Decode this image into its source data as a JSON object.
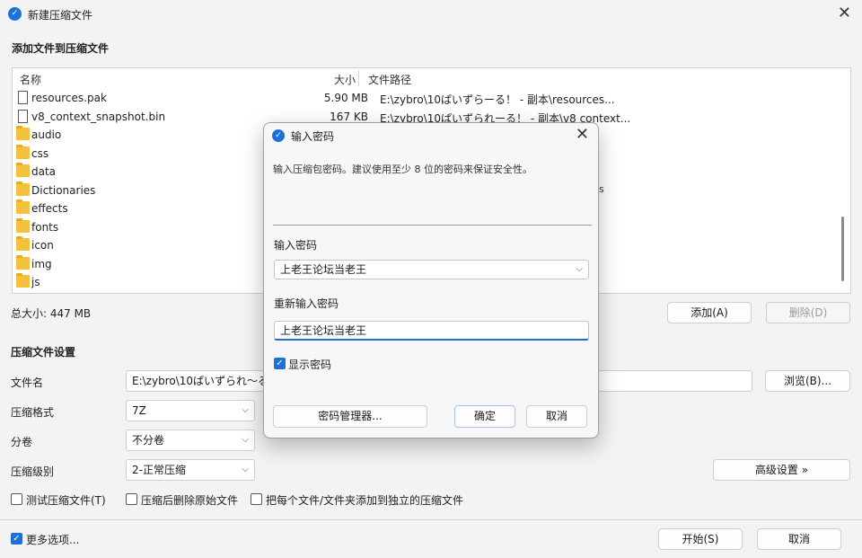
{
  "window": {
    "title": "新建压缩文件",
    "add_section_label": "添加文件到压缩文件"
  },
  "file_list": {
    "columns": {
      "name": "名称",
      "size": "大小",
      "path": "文件路径"
    },
    "rows": [
      {
        "type": "file",
        "name": "resources.pak",
        "size": "5.90 MB",
        "path": "E:\\zybro\\10ぱいずらーる！ - 副本\\resources..."
      },
      {
        "type": "file",
        "name": "v8_context_snapshot.bin",
        "size": "167 KB",
        "path": "E:\\zybro\\10ぱいずられーる！ - 副本\\v8 context..."
      },
      {
        "type": "folder",
        "name": "audio",
        "size": "",
        "path": ""
      },
      {
        "type": "folder",
        "name": "css",
        "size": "",
        "path": ""
      },
      {
        "type": "folder",
        "name": "data",
        "size": "",
        "path": ""
      },
      {
        "type": "folder",
        "name": "Dictionaries",
        "size": "",
        "path": ""
      },
      {
        "type": "folder",
        "name": "effects",
        "size": "",
        "path": ""
      },
      {
        "type": "folder",
        "name": "fonts",
        "size": "",
        "path": ""
      },
      {
        "type": "folder",
        "name": "icon",
        "size": "",
        "path": ""
      },
      {
        "type": "folder",
        "name": "img",
        "size": "",
        "path": ""
      },
      {
        "type": "folder",
        "name": "js",
        "size": "",
        "path": ""
      }
    ],
    "partial_path_fragment": "s"
  },
  "summary": {
    "total_size": "总大小: 447 MB",
    "add_button": "添加(A)",
    "delete_button": "删除(D)"
  },
  "settings": {
    "section_label": "压缩文件设置",
    "filename_label": "文件名",
    "filename_value": "E:\\zybro\\10ぱいずられ～る",
    "browse_button": "浏览(B)...",
    "format_label": "压缩格式",
    "format_value": "7Z",
    "volume_label": "分卷",
    "volume_value": "不分卷",
    "level_label": "压缩级别",
    "level_value": "2-正常压缩",
    "advanced_button": "高级设置 »",
    "test_checkbox": "测试压缩文件(T)",
    "delete_after_checkbox": "压缩后删除原始文件",
    "separate_checkbox": "把每个文件/文件夹添加到独立的压缩文件",
    "more_options": "更多选项...",
    "start_button": "开始(S)",
    "cancel_button": "取消"
  },
  "dialog": {
    "title": "输入密码",
    "description": "输入压缩包密码。建议使用至少 8 位的密码来保证安全性。",
    "password_label": "输入密码",
    "password_value": "上老王论坛当老王",
    "confirm_label": "重新输入密码",
    "confirm_value": "上老王论坛当老王",
    "show_password": "显示密码",
    "password_manager_button": "密码管理器...",
    "ok_button": "确定",
    "cancel_button": "取消"
  },
  "colors": {
    "accent": "#1e6fd9",
    "folder": "#f4c13c"
  },
  "icons": {
    "app": "app-logo-icon",
    "close": "close-icon",
    "folder": "folder-icon",
    "file": "file-icon",
    "chevron": "chevron-down-icon",
    "check": "checkmark-icon"
  }
}
